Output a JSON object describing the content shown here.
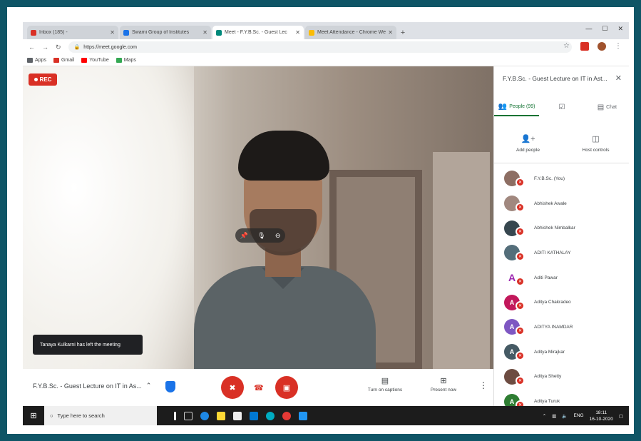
{
  "browser": {
    "tabs": [
      {
        "label": "Inbox (185) - ",
        "favicon_color": "#d93025",
        "active": false
      },
      {
        "label": "Swami Group of Institutes",
        "favicon_color": "#1a73e8",
        "active": false
      },
      {
        "label": "Meet - F.Y.B.Sc. - Guest Lec",
        "favicon_color": "#00897b",
        "active": true
      },
      {
        "label": "Meet Attendance - Chrome We",
        "favicon_color": "#fbbc04",
        "active": false
      }
    ],
    "url": "https://meet.google.com",
    "bookmarks": [
      {
        "label": "Apps",
        "color": "#5f6368"
      },
      {
        "label": "Gmail",
        "color": "#d93025"
      },
      {
        "label": "YouTube",
        "color": "#ff0000"
      },
      {
        "label": "Maps",
        "color": "#34a853"
      }
    ]
  },
  "meet": {
    "rec_label": "REC",
    "toast": "Tanaya Kulkarni has left the meeting",
    "meeting_title": "F.Y.B.Sc. - Guest Lecture on IT in As...",
    "captions_label": "Turn on captions",
    "present_label": "Present now"
  },
  "panel": {
    "title": "F.Y.B.Sc. - Guest Lecture on IT in Ast...",
    "tabs": [
      {
        "label": "People (99)",
        "icon": "people-icon"
      },
      {
        "label": "",
        "icon": "activities-icon"
      },
      {
        "label": "Chat",
        "icon": "chat-icon"
      }
    ],
    "actions": [
      {
        "label": "Add people",
        "icon": "add-person-icon"
      },
      {
        "label": "Host controls",
        "icon": "host-controls-icon"
      }
    ],
    "people": [
      {
        "name": "F.Y.B.Sc. (You)",
        "initial": "",
        "color": "#8d6e63"
      },
      {
        "name": "Abhishek Awale",
        "initial": "",
        "color": "#a1887f"
      },
      {
        "name": "Abhishek Nimbalkar",
        "initial": "",
        "color": "#37474f"
      },
      {
        "name": "ADITI KATHALAY",
        "initial": "",
        "color": "#546e7a"
      },
      {
        "name": "Aditi Pawar",
        "initial": "A",
        "color": "#ffffff"
      },
      {
        "name": "Aditya Chakradeo",
        "initial": "A",
        "color": "#c2185b"
      },
      {
        "name": "ADITYA INAMDAR",
        "initial": "A",
        "color": "#7e57c2"
      },
      {
        "name": "Aditya Mirajkar",
        "initial": "A",
        "color": "#455a64"
      },
      {
        "name": "Aditya Shetty",
        "initial": "",
        "color": "#6d4c41"
      },
      {
        "name": "Aditya Turuk",
        "initial": "A",
        "color": "#2e7d32"
      }
    ]
  },
  "taskbar": {
    "search_placeholder": "Type here to search",
    "lang": "ENG",
    "time": "18:11",
    "date": "16-10-2020"
  }
}
